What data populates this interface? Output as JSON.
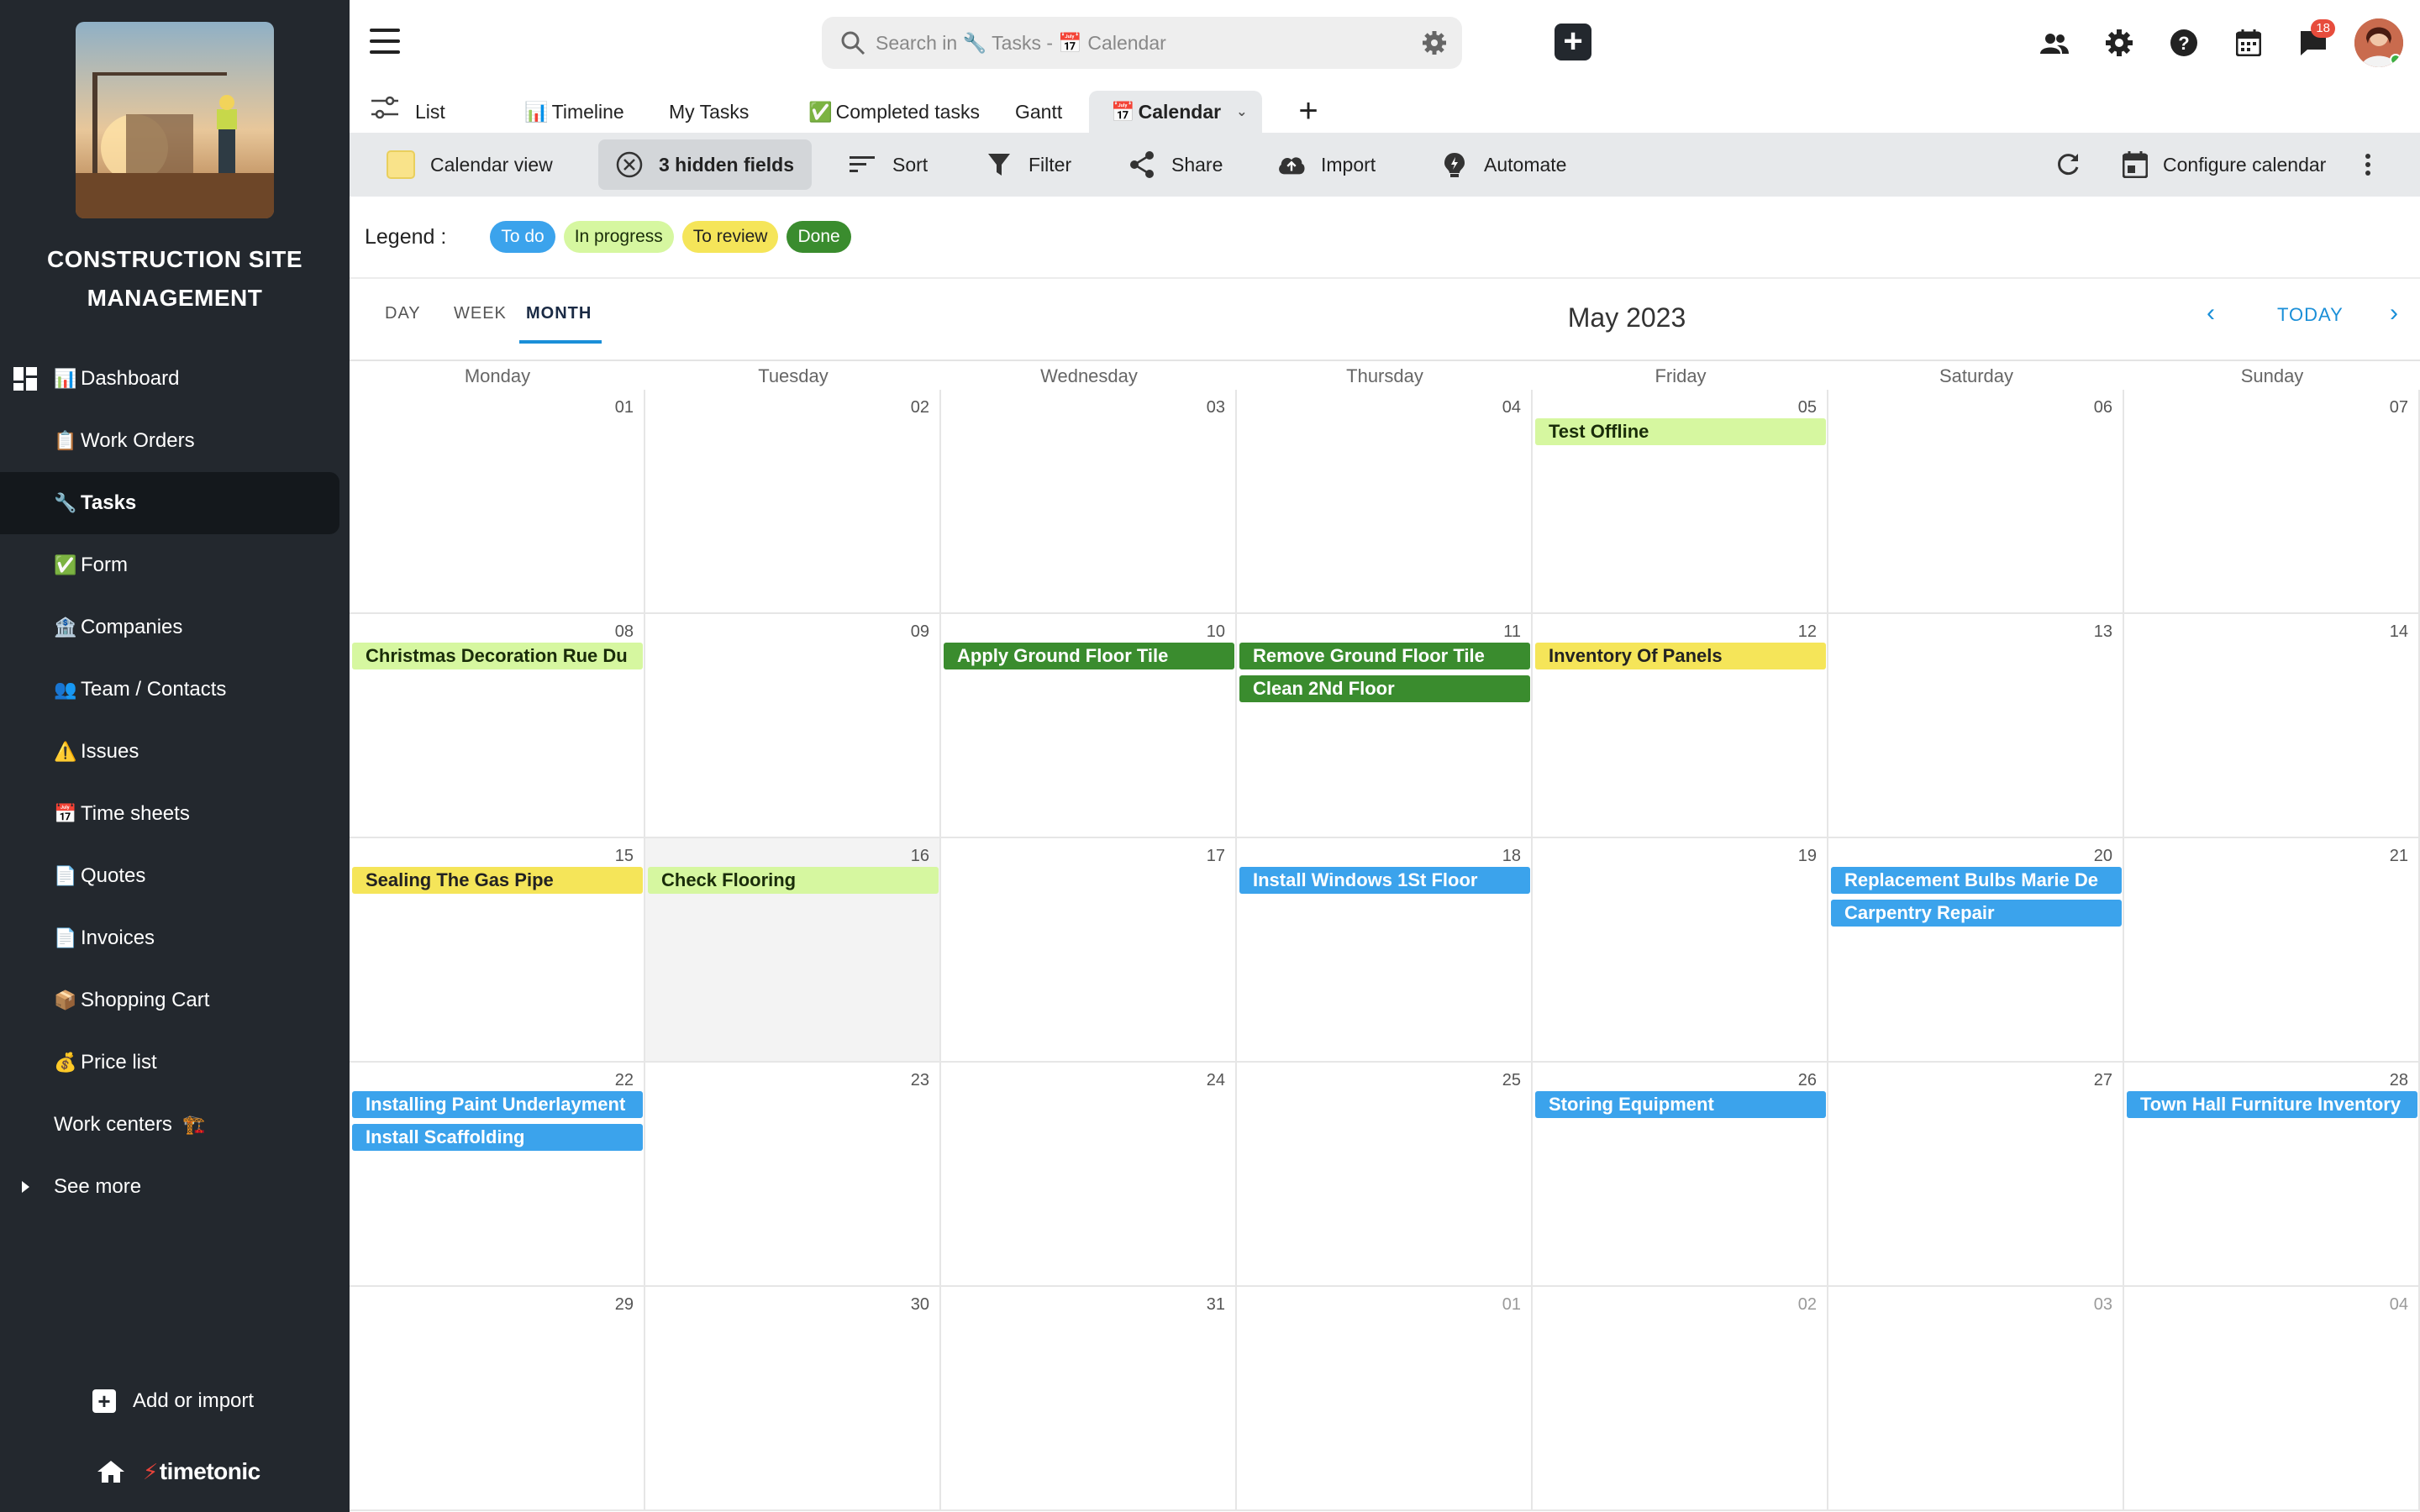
{
  "sidebar": {
    "app_title": "Construction Site Management",
    "items": [
      {
        "label": "Dashboard",
        "emoji": "📊"
      },
      {
        "label": "Work Orders",
        "emoji": "📋"
      },
      {
        "label": "Tasks",
        "emoji": "🔧"
      },
      {
        "label": "Form",
        "emoji": "✅"
      },
      {
        "label": "Companies",
        "emoji": "🏦"
      },
      {
        "label": "Team / Contacts",
        "emoji": "👥"
      },
      {
        "label": "Issues",
        "emoji": "⚠️"
      },
      {
        "label": "Time sheets",
        "emoji": "📅"
      },
      {
        "label": "Quotes",
        "emoji": "📄"
      },
      {
        "label": "Invoices",
        "emoji": "📄"
      },
      {
        "label": "Shopping Cart",
        "emoji": "📦"
      },
      {
        "label": "Price list",
        "emoji": "💰"
      },
      {
        "label": "Work centers",
        "emoji": "🏗️"
      }
    ],
    "see_more": "See more",
    "add_import": "Add or import",
    "brand": "timetonic"
  },
  "topbar": {
    "search_placeholder": "Search in 🔧 Tasks - 📅 Calendar",
    "notification_count": "18"
  },
  "view_tabs": [
    {
      "label": "List",
      "emoji": ""
    },
    {
      "label": "Timeline",
      "emoji": "📊"
    },
    {
      "label": "My Tasks",
      "emoji": ""
    },
    {
      "label": "Completed tasks",
      "emoji": "✅"
    },
    {
      "label": "Gantt",
      "emoji": ""
    },
    {
      "label": "Calendar",
      "emoji": "📅"
    }
  ],
  "toolbar": {
    "calendar_view": "Calendar view",
    "hidden_fields": "3 hidden fields",
    "sort": "Sort",
    "filter": "Filter",
    "share": "Share",
    "import": "Import",
    "automate": "Automate",
    "configure": "Configure calendar"
  },
  "legend": {
    "label": "Legend :",
    "items": [
      {
        "label": "To do",
        "bg": "#3ba3ec",
        "fg": "#ffffff"
      },
      {
        "label": "In progress",
        "bg": "#d6f7a0",
        "fg": "#1a2d0a"
      },
      {
        "label": "To review",
        "bg": "#f5e559",
        "fg": "#222222"
      },
      {
        "label": "Done",
        "bg": "#3a8c2e",
        "fg": "#ffffff"
      }
    ]
  },
  "calendar": {
    "modes": [
      "DAY",
      "WEEK",
      "MONTH"
    ],
    "active_mode": "MONTH",
    "title": "May 2023",
    "today": "TODAY",
    "days": [
      "Monday",
      "Tuesday",
      "Wednesday",
      "Thursday",
      "Friday",
      "Saturday",
      "Sunday"
    ],
    "weeks": [
      [
        "01",
        "02",
        "03",
        "04",
        "05",
        "06",
        "07"
      ],
      [
        "08",
        "09",
        "10",
        "11",
        "12",
        "13",
        "14"
      ],
      [
        "15",
        "16",
        "17",
        "18",
        "19",
        "20",
        "21"
      ],
      [
        "22",
        "23",
        "24",
        "25",
        "26",
        "27",
        "28"
      ],
      [
        "29",
        "30",
        "31",
        "01",
        "02",
        "03",
        "04"
      ]
    ],
    "highlighted_cell": {
      "week": 2,
      "day": 1
    },
    "events": [
      {
        "week": 0,
        "day": 4,
        "slot": 0,
        "title": "Test Offline",
        "status": "prog"
      },
      {
        "week": 1,
        "day": 0,
        "slot": 0,
        "title": "Christmas Decoration Rue Du",
        "status": "prog"
      },
      {
        "week": 1,
        "day": 2,
        "slot": 0,
        "title": "Apply Ground Floor Tile",
        "status": "done"
      },
      {
        "week": 1,
        "day": 3,
        "slot": 0,
        "title": "Remove Ground Floor Tile",
        "status": "done"
      },
      {
        "week": 1,
        "day": 3,
        "slot": 1,
        "title": "Clean 2Nd Floor",
        "status": "done"
      },
      {
        "week": 1,
        "day": 4,
        "slot": 0,
        "title": "Inventory Of Panels",
        "status": "review"
      },
      {
        "week": 2,
        "day": 0,
        "slot": 0,
        "title": "Sealing The Gas Pipe",
        "status": "review"
      },
      {
        "week": 2,
        "day": 1,
        "slot": 0,
        "title": "Check Flooring",
        "status": "prog"
      },
      {
        "week": 2,
        "day": 3,
        "slot": 0,
        "title": "Install Windows 1St Floor",
        "status": "todo"
      },
      {
        "week": 2,
        "day": 5,
        "slot": 0,
        "title": "Replacement Bulbs Marie De",
        "status": "todo"
      },
      {
        "week": 2,
        "day": 5,
        "slot": 1,
        "title": "Carpentry Repair",
        "status": "todo"
      },
      {
        "week": 3,
        "day": 0,
        "slot": 0,
        "title": "Installing Paint Underlayment",
        "status": "todo"
      },
      {
        "week": 3,
        "day": 0,
        "slot": 1,
        "title": "Install Scaffolding",
        "status": "todo"
      },
      {
        "week": 3,
        "day": 4,
        "slot": 0,
        "title": "Storing Equipment",
        "status": "todo"
      },
      {
        "week": 3,
        "day": 6,
        "slot": 0,
        "title": "Town Hall Furniture Inventory",
        "status": "todo"
      }
    ]
  }
}
